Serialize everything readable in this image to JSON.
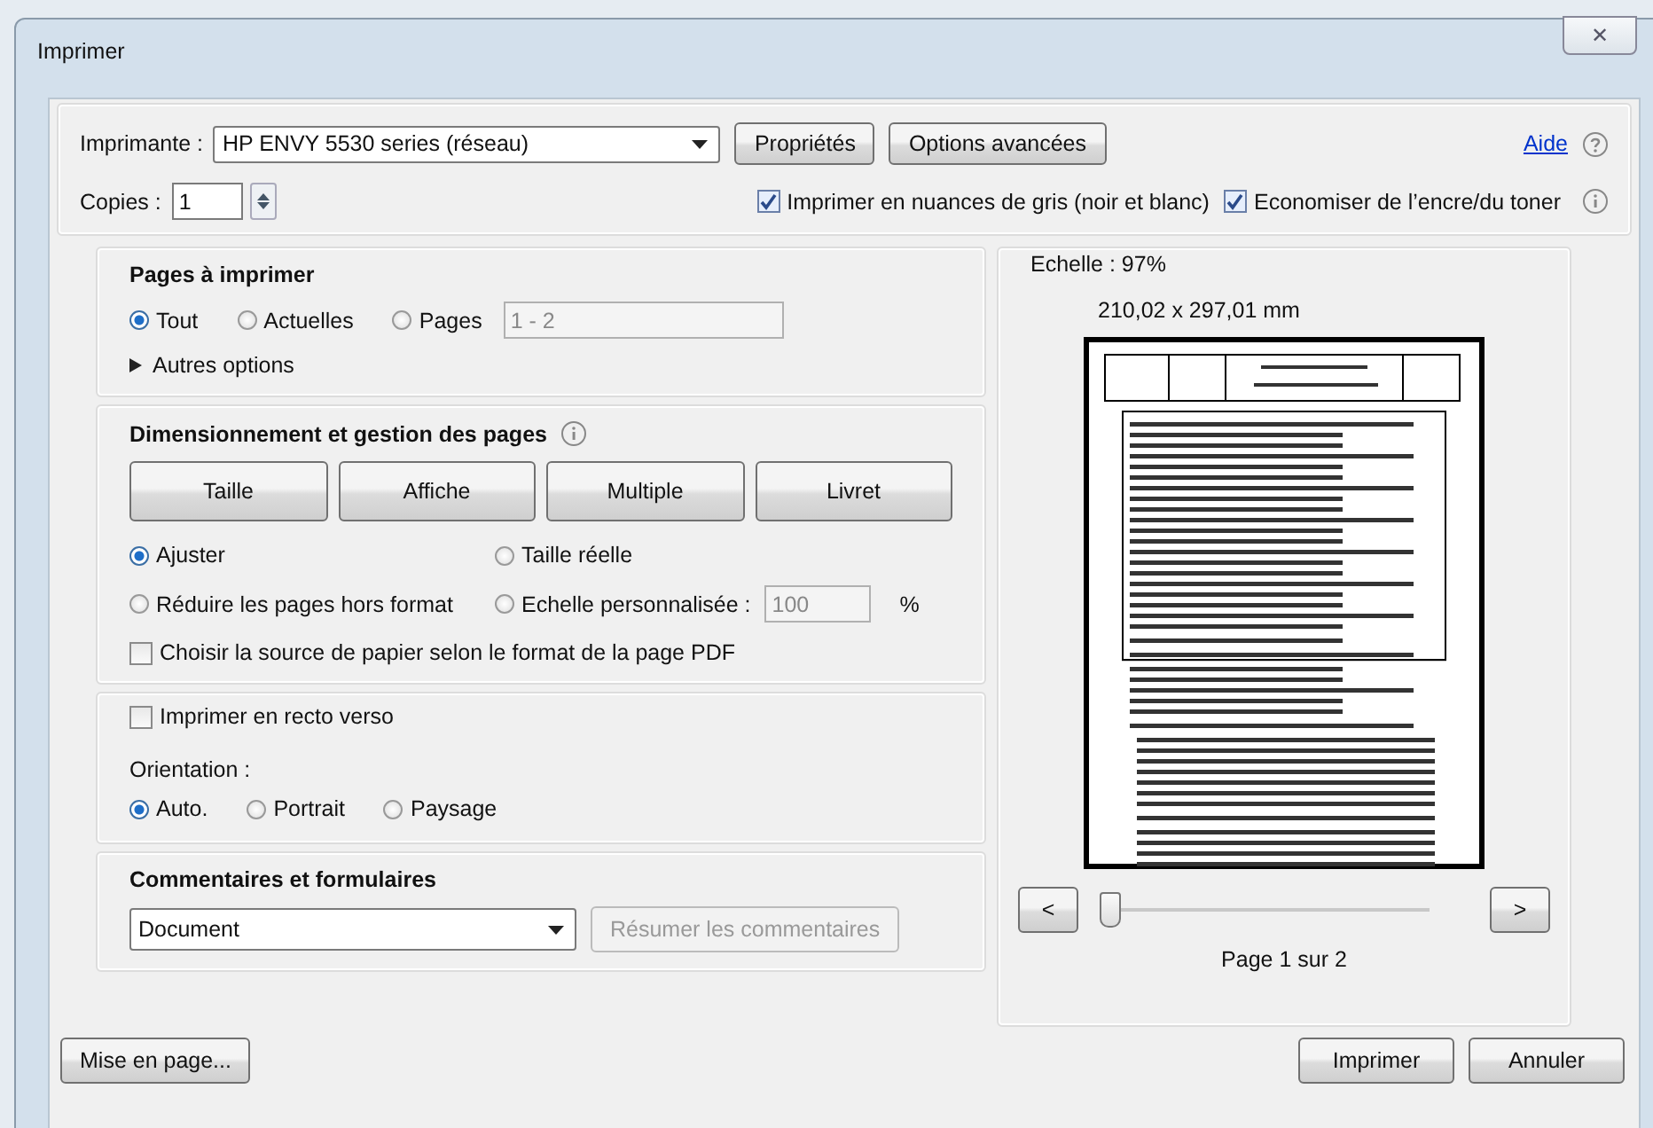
{
  "window": {
    "title": "Imprimer",
    "close": "✕"
  },
  "printer": {
    "label": "Imprimante :",
    "value": "HP ENVY 5530 series (réseau)",
    "buttons": [
      "Propriétés",
      "Options avancées"
    ],
    "help": "Aide"
  },
  "copies": {
    "label": "Copies :",
    "value": "1"
  },
  "options": [
    {
      "label": "Imprimer en nuances de gris (noir et blanc)",
      "checked": true
    },
    {
      "label": "Economiser de l’encre/du toner",
      "checked": true
    }
  ],
  "pages_section": {
    "title": "Pages à imprimer",
    "radios": [
      {
        "label": "Tout",
        "selected": true
      },
      {
        "label": "Actuelles",
        "selected": false
      },
      {
        "label": "Pages",
        "selected": false
      }
    ],
    "range": {
      "value": "1 - 2",
      "disabled": true
    },
    "more_options": "Autres options"
  },
  "sizing": {
    "title": "Dimensionnement et gestion des pages",
    "modes": [
      "Taille",
      "Affiche",
      "Multiple",
      "Livret"
    ],
    "radios": [
      {
        "label": "Ajuster",
        "selected": true
      },
      {
        "label": "Taille réelle",
        "selected": false
      },
      {
        "label": "Réduire les pages hors format",
        "selected": false
      },
      {
        "label": "Echelle personnalisée :",
        "selected": false
      }
    ],
    "scale": {
      "value": "100",
      "disabled": true,
      "unit": "%"
    },
    "paper_source": {
      "label": "Choisir la source de papier selon le format de la page PDF",
      "checked": false
    }
  },
  "duplex": {
    "label": "Imprimer en recto verso",
    "checked": false
  },
  "orientation": {
    "label": "Orientation :",
    "radios": [
      {
        "label": "Auto.",
        "selected": true
      },
      {
        "label": "Portrait",
        "selected": false
      },
      {
        "label": "Paysage",
        "selected": false
      }
    ]
  },
  "comments": {
    "title": "Commentaires et formulaires",
    "value": "Document",
    "summary": {
      "label": "Résumer les commentaires",
      "disabled": true
    }
  },
  "preview": {
    "scale": "Echelle :  97%",
    "size": "210,02 x 297,01 mm",
    "prev": "<",
    "next": ">",
    "slider": {
      "level": 0
    },
    "page": "Page 1 sur 2"
  },
  "footer": {
    "setup": "Mise en page...",
    "print": "Imprimer",
    "cancel": "Annuler"
  }
}
